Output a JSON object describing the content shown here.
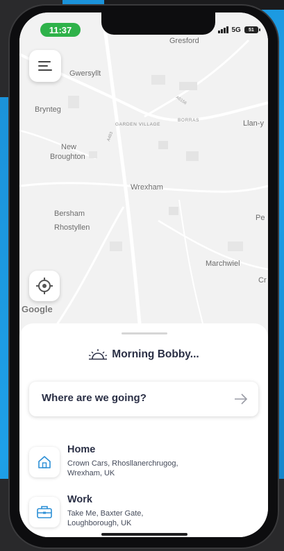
{
  "status_bar": {
    "time": "11:37",
    "network": "5G",
    "battery": "51"
  },
  "map": {
    "places": [
      {
        "name": "Gresford",
        "kind": "town"
      },
      {
        "name": "Gwersyllt",
        "kind": "town"
      },
      {
        "name": "Brynteg",
        "kind": "town"
      },
      {
        "name": "GARDEN VILLAGE",
        "kind": "district"
      },
      {
        "name": "BORRAS",
        "kind": "district"
      },
      {
        "name": "Llan-y",
        "kind": "town"
      },
      {
        "name": "New",
        "kind": "town"
      },
      {
        "name": "Broughton",
        "kind": "town"
      },
      {
        "name": "Wrexham",
        "kind": "city"
      },
      {
        "name": "Bersham",
        "kind": "town"
      },
      {
        "name": "Rhostyllen",
        "kind": "town"
      },
      {
        "name": "Pe",
        "kind": "town"
      },
      {
        "name": "Marchwiel",
        "kind": "town"
      },
      {
        "name": "Cr",
        "kind": "town"
      }
    ],
    "roads": [
      "A483",
      "A5156"
    ],
    "attribution": "Google"
  },
  "sheet": {
    "greeting": "Morning Bobby...",
    "search_placeholder": "Where are we going?",
    "saved_places": [
      {
        "title": "Home",
        "address_line1": "Crown Cars, Rhosllanerchrugog,",
        "address_line2": "Wrexham, UK",
        "icon": "home-icon"
      },
      {
        "title": "Work",
        "address_line1": "Take Me, Baxter Gate,",
        "address_line2": "Loughborough, UK",
        "icon": "briefcase-icon"
      }
    ]
  },
  "colors": {
    "background_blue": "#1ea0e8",
    "time_pill": "#2fb24a",
    "text_dark": "#2a2f45",
    "map_bg": "#f2f2f2"
  }
}
